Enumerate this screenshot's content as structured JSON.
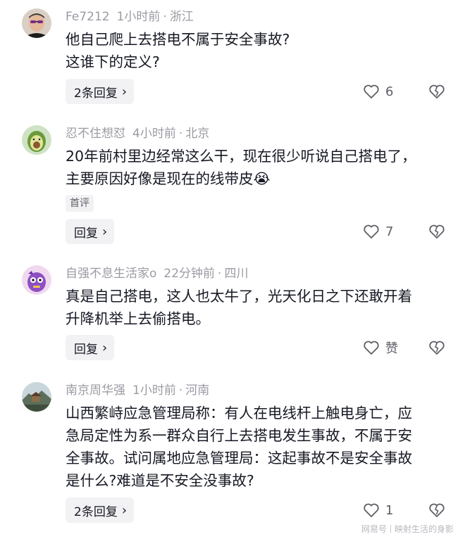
{
  "comments": [
    {
      "username": "Fe7212",
      "time": "1小时前",
      "location": "浙江",
      "text": "他自己爬上去搭电不属于安全事故?\n这谁下的定义?",
      "tag": "",
      "reply_label": "2条回复",
      "likes": "6",
      "avatar_icon": "man-with-sunglasses-avatar"
    },
    {
      "username": "忍不住想怼",
      "time": "4小时前",
      "location": "北京",
      "text": "20年前村里边经常这么干，现在很少听说自己搭电了，\n主要原因好像是现在的线带皮",
      "emoji": "😭",
      "tag": "首评",
      "reply_label": "回复",
      "likes": "7",
      "avatar_icon": "avocado-avatar"
    },
    {
      "username": "自强不息生活家o",
      "time": "22分钟前",
      "location": "四川",
      "text": "真是自己搭电，这人也太牛了，光天化日之下还敢开着\n升降机举上去偷搭电。",
      "tag": "",
      "reply_label": "回复",
      "likes": "赞",
      "avatar_icon": "purple-cartoon-avatar"
    },
    {
      "username": "南京周华强",
      "time": "1小时前",
      "location": "河南",
      "text": "山西繁峙应急管理局称：有人在电线杆上触电身亡，应\n急局定性为系一群众自行上去搭电发生事故，不属于安\n全事故。试问属地应急管理局：这起事故不是安全事故\n是什么?难道是不安全没事故?",
      "tag": "",
      "reply_label": "2条回复",
      "likes": "1",
      "avatar_icon": "landscape-avatar"
    }
  ],
  "footer": {
    "brand": "网易号",
    "account": "映射生活的身影"
  },
  "colors": {
    "text": "#161823",
    "meta": "#9a9ba3",
    "button_bg": "#f2f2f4"
  }
}
